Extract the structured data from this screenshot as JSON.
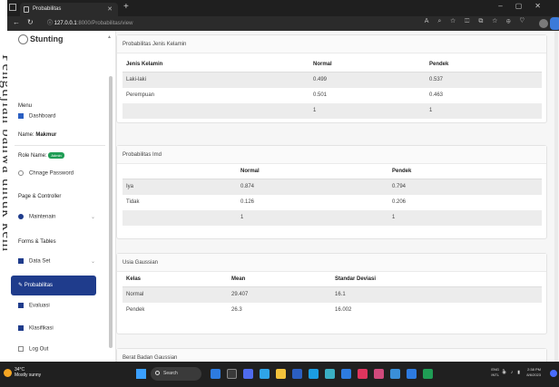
{
  "outer": {
    "side_text": "Pengujian bahwa untuk kem"
  },
  "browser": {
    "tab_title": "Probabilitas",
    "url_host": "127.0.0.1",
    "url_rest": ":8000/Probabilitas/view"
  },
  "sidebar": {
    "logo": "Stunting",
    "menu_label": "Menu",
    "dashboard": "Dashboard",
    "name_label": "Name:",
    "name_value": "Makmur",
    "role_label": "Role Name:",
    "role_value": "Admin",
    "change_password": "Chnage Password",
    "page_controller": "Page & Controller",
    "maintenance": "Maintenain",
    "forms_tables": "Forms & Tables",
    "data_set": "Data Set",
    "probabilitas": "Probabilitas",
    "evaluasi": "Evaluasi",
    "klasifikasi": "Klasifikasi",
    "logout": "Log Out"
  },
  "cards": {
    "jenis_kelamin": {
      "title": "Probabilitas Jenis Kelamin",
      "headers": [
        "Jenis Kelamin",
        "Normal",
        "Pendek"
      ],
      "rows": [
        [
          "Laki-laki",
          "0.499",
          "0.537"
        ],
        [
          "Perempuan",
          "0.501",
          "0.463"
        ],
        [
          "",
          "1",
          "1"
        ]
      ]
    },
    "imd": {
      "title": "Probabilitas Imd",
      "headers": [
        "",
        "Normal",
        "Pendek"
      ],
      "rows": [
        [
          "Iya",
          "0.874",
          "0.794"
        ],
        [
          "Tidak",
          "0.126",
          "0.206"
        ],
        [
          "",
          "1",
          "1"
        ]
      ]
    },
    "usia": {
      "title": "Usia Gaussian",
      "headers": [
        "Kelas",
        "Mean",
        "Standar Deviasi"
      ],
      "rows": [
        [
          "Normal",
          "29.407",
          "16.1"
        ],
        [
          "Pendek",
          "26.3",
          "16.002"
        ]
      ]
    },
    "berat": {
      "title": "Berat Badan Gaussian"
    }
  },
  "taskbar": {
    "temp": "34°C",
    "weather": "Mostly sunny",
    "search": "Search",
    "lang1": "ENG",
    "lang2": "INTL",
    "time": "2:38 PM",
    "date": "8/6/2023"
  }
}
